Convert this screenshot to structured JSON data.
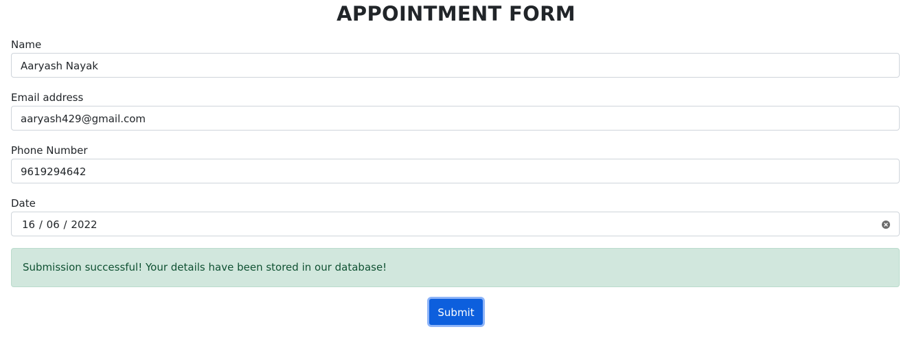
{
  "form": {
    "title": "APPOINTMENT FORM",
    "fields": {
      "name": {
        "label": "Name",
        "value": "Aaryash Nayak"
      },
      "email": {
        "label": "Email address",
        "value": "aaryash429@gmail.com"
      },
      "phone": {
        "label": "Phone Number",
        "value": "9619294642"
      },
      "date": {
        "label": "Date",
        "value": "16 / 06 / 2022"
      }
    },
    "alert": {
      "message": "Submission successful! Your details have been stored in our database!",
      "color": "#d1e7dd",
      "text_color": "#0f5132"
    },
    "submit_label": "Submit",
    "accent_color": "#0d5fdd"
  }
}
